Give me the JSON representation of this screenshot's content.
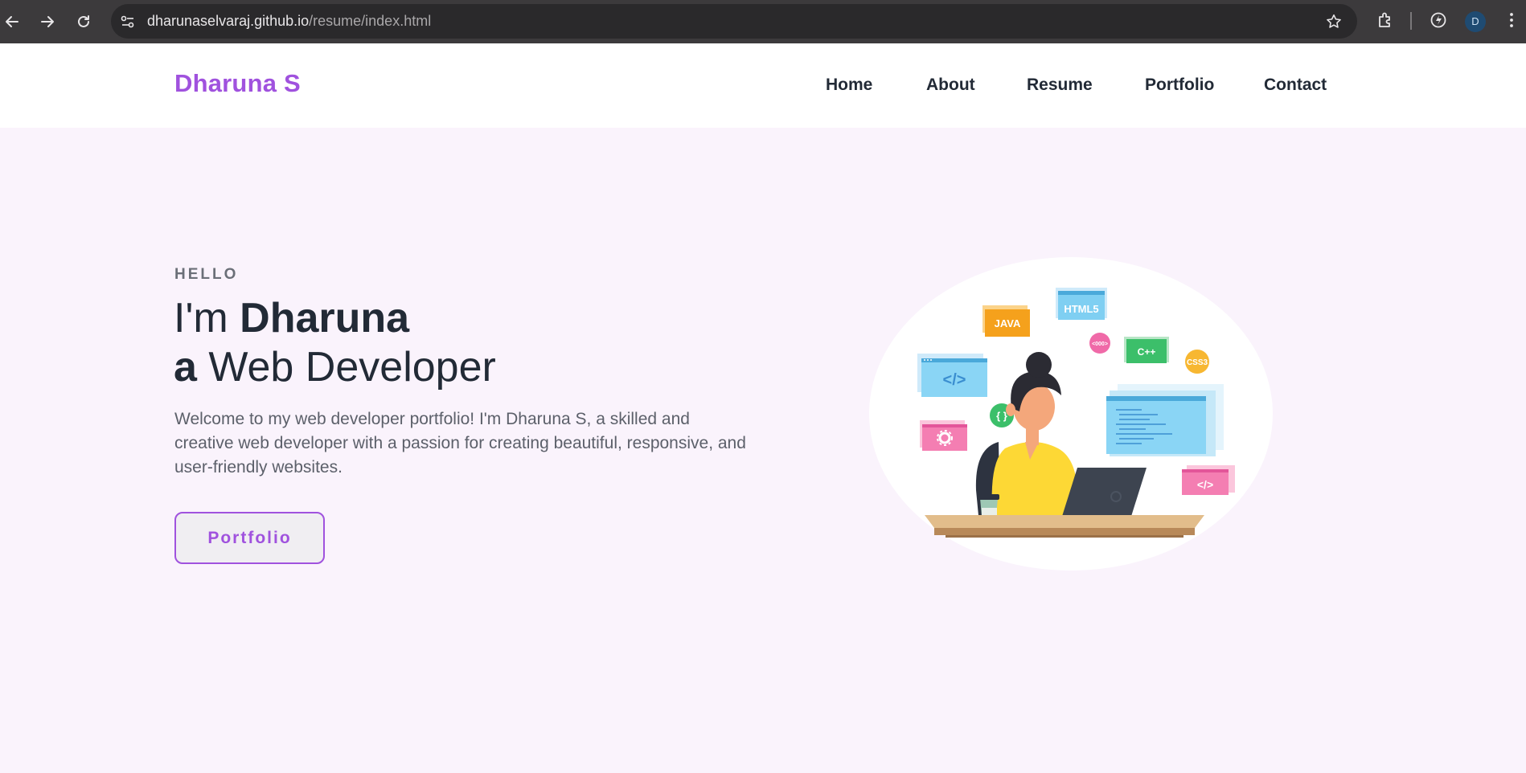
{
  "browser": {
    "url_host": "dharunaselvaraj.github.io",
    "url_path": "/resume/index.html",
    "profile_initial": "D"
  },
  "site": {
    "logo": "Dharuna S",
    "nav": [
      "Home",
      "About",
      "Resume",
      "Portfolio",
      "Contact"
    ]
  },
  "hero": {
    "eyebrow": "HELLO",
    "line1_prefix": "I'm ",
    "line1_name": "Dharuna",
    "line2_prefix": "a",
    "line2_rest": " Web Developer",
    "intro": "Welcome to my web developer portfolio! I'm Dharuna S, a skilled and creative web developer with a passion for creating beautiful, responsive, and user-friendly websites.",
    "cta_label": "Portfolio"
  },
  "illustration": {
    "badges": [
      "JAVA",
      "HTML5",
      "C++",
      "CSS3",
      "</>",
      "{ }",
      "</>",
      "<000>"
    ]
  },
  "colors": {
    "accent": "#a052de",
    "text": "#222a36",
    "hero_bg": "#faf3fc"
  }
}
